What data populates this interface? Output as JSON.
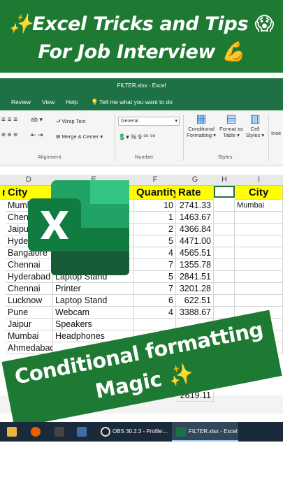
{
  "banner": {
    "line1": "✨Excel Tricks and Tips 😱",
    "line2": "For Job Interview 💪"
  },
  "window": {
    "title": "FILTER.xlsx - Excel"
  },
  "menu": [
    "Review",
    "View",
    "Help",
    "Tell me what you want to do"
  ],
  "ribbon": {
    "wrap_text": "Wrap Text",
    "merge_center": "Merge & Center",
    "alignment_label": "Alignment",
    "number_format": "General",
    "number_label": "Number",
    "percent": "%",
    "comma": "9",
    "conditional": "Conditional",
    "formatting": "Formatting",
    "format_as": "Format as",
    "table": "Table",
    "cell": "Cell",
    "styles": "Styles",
    "styles_label": "Styles",
    "insert": "Inse"
  },
  "columns": [
    "D",
    "E",
    "F",
    "G",
    "H",
    "I"
  ],
  "headers": {
    "col_c": "n",
    "city": "City",
    "quantity": "Quantity",
    "rate": "Rate",
    "city2": "City"
  },
  "filter_value": "Mumbai",
  "rows": [
    {
      "city": "Mumb",
      "product": "",
      "qty": "10",
      "rate": "2741.33"
    },
    {
      "city": "Chenn",
      "product": "",
      "qty": "1",
      "rate": "1463.67"
    },
    {
      "city": "Jaipur",
      "product": "",
      "qty": "2",
      "rate": "4366.84"
    },
    {
      "city": "Hyder",
      "product": "",
      "qty": "5",
      "rate": "4471.00"
    },
    {
      "city": "Bangalore",
      "product": "",
      "qty": "4",
      "rate": "4565.51"
    },
    {
      "city": "Chennai",
      "product": "",
      "qty": "7",
      "rate": "1355.78"
    },
    {
      "city": "Hyderabad",
      "product": "Laptop Stand",
      "qty": "5",
      "rate": "2841.51"
    },
    {
      "city": "Chennai",
      "product": "Printer",
      "qty": "7",
      "rate": "3201.28"
    },
    {
      "city": "Lucknow",
      "product": "Laptop Stand",
      "qty": "6",
      "rate": "622.51"
    },
    {
      "city": "Pune",
      "product": "Webcam",
      "qty": "4",
      "rate": "3388.67"
    },
    {
      "city": "Jaipur",
      "product": "Speakers",
      "qty": "",
      "rate": ""
    },
    {
      "city": "Mumbai",
      "product": "Headphones",
      "qty": "",
      "rate": ""
    },
    {
      "city": "Ahmedabad",
      "product": "",
      "qty": "",
      "rate": ""
    }
  ],
  "partial_rate": "2619.11",
  "magic": {
    "line1": "Conditional formatting",
    "line2": "Magic ✨"
  },
  "taskbar": {
    "obs": "OBS 30.2.3 - Profile:...",
    "excel": "FILTER.xlsx - Excel"
  },
  "colors": {
    "banner": "#1e7a32",
    "excel_green": "#1e7145",
    "header_yellow": "#ffff00"
  }
}
